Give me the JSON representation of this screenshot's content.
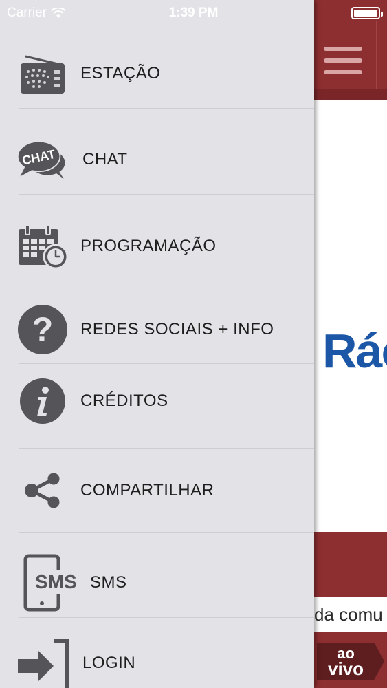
{
  "status_bar": {
    "carrier": "Carrier",
    "time": "1:39 PM",
    "wifi_icon": "wifi-icon",
    "battery_icon": "battery-icon"
  },
  "menu": {
    "items": [
      {
        "label": "ESTAÇÃO",
        "icon": "radio-icon"
      },
      {
        "label": "CHAT",
        "icon": "chat-bubble-icon"
      },
      {
        "label": "PROGRAMAÇÃO",
        "icon": "calendar-clock-icon"
      },
      {
        "label": "REDES SOCIAIS + INFO",
        "icon": "question-circle-icon"
      },
      {
        "label": "CRÉDITOS",
        "icon": "info-circle-icon"
      },
      {
        "label": "COMPARTILHAR",
        "icon": "share-icon"
      },
      {
        "label": "SMS",
        "icon": "sms-phone-icon"
      },
      {
        "label": "LOGIN",
        "icon": "login-icon"
      }
    ]
  },
  "icon_text": {
    "chat": "CHAT",
    "sms": "SMS"
  },
  "background": {
    "menu_icon": "hamburger-icon",
    "logo_text": "Rác",
    "ticker_text": "da comu",
    "live_button": {
      "line1": "ao",
      "line2": "vivo"
    }
  },
  "colors": {
    "drawer_bg": "#e3e2e6",
    "header_red": "#8d2e30",
    "logo_blue": "#1b57a6",
    "icon_gray": "#555459"
  }
}
